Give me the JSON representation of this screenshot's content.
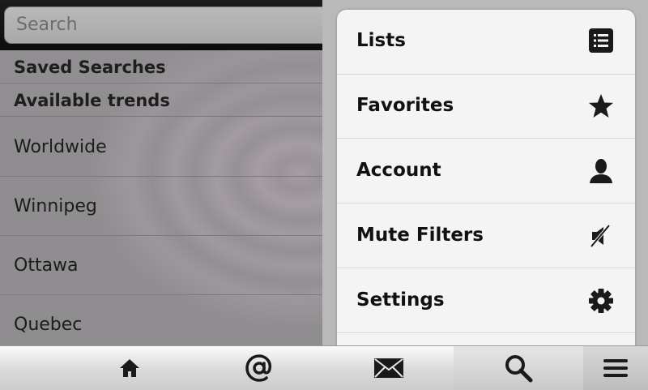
{
  "search": {
    "placeholder": "Search"
  },
  "sections": {
    "saved_searches": "Saved Searches",
    "available_trends": "Available trends"
  },
  "trends": [
    "Worldwide",
    "Winnipeg",
    "Ottawa",
    "Quebec"
  ],
  "menu": {
    "items": [
      {
        "label": "Lists",
        "icon": "list-icon"
      },
      {
        "label": "Favorites",
        "icon": "star-icon"
      },
      {
        "label": "Account",
        "icon": "person-icon"
      },
      {
        "label": "Mute Filters",
        "icon": "mute-icon"
      },
      {
        "label": "Settings",
        "icon": "gear-icon"
      }
    ]
  },
  "tabbar": {
    "tabs": [
      {
        "name": "home",
        "icon": "home-icon"
      },
      {
        "name": "mentions",
        "icon": "at-icon"
      },
      {
        "name": "messages",
        "icon": "envelope-icon"
      },
      {
        "name": "search",
        "icon": "search-icon"
      },
      {
        "name": "menu",
        "icon": "menu-icon"
      }
    ],
    "selected": "search"
  },
  "colors": {
    "menu_bg": "#f4f4f4",
    "top_bar": "#111111",
    "icon_dark": "#1a1a1a"
  }
}
